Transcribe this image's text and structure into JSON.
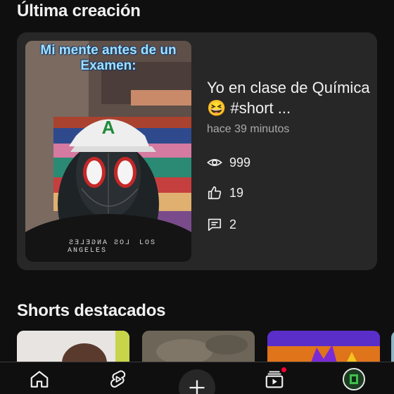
{
  "sections": {
    "latest_title": "Última creación",
    "shorts_title": "Shorts destacados"
  },
  "latest_video": {
    "thumbnail_caption": "Mi mente antes de un Examen:",
    "title": "Yo en clase de Química 😆 #short ...",
    "time_ago": "hace 39 minutos",
    "views": "999",
    "likes": "19",
    "comments": "2",
    "shirt_text_1": "LOS ANGELES",
    "shirt_text_2": "LOS ANGELES"
  },
  "icons": {
    "views": "eye-icon",
    "likes": "thumbs-up-icon",
    "comments": "comment-icon",
    "nav": [
      "home-icon",
      "shorts-icon",
      "create-plus-icon",
      "subscriptions-icon",
      "avatar"
    ]
  },
  "colors": {
    "background": "#0f0f0f",
    "card": "#272727",
    "text_primary": "#f1f1f1",
    "text_secondary": "#aaaaaa",
    "notification": "#ff0033"
  }
}
